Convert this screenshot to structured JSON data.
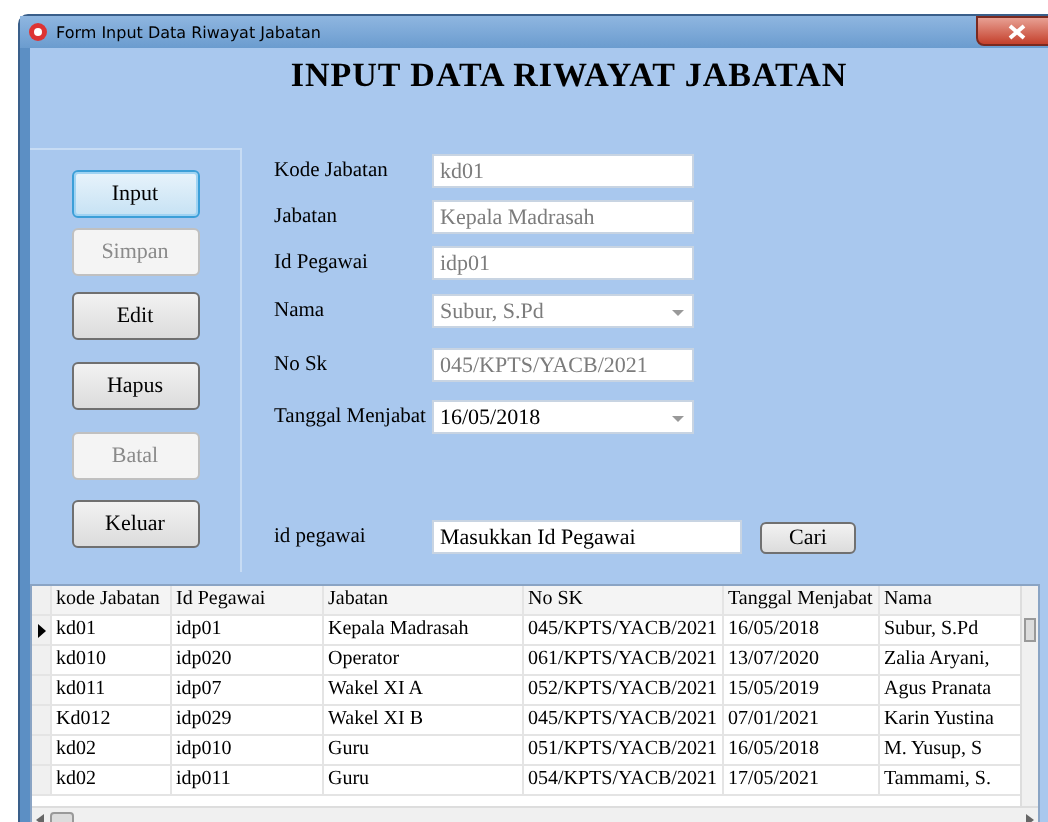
{
  "window": {
    "title": "Form Input Data Riwayat Jabatan"
  },
  "heading": "INPUT DATA RIWAYAT JABATAN",
  "buttons": [
    {
      "label": "Input",
      "disabled": false,
      "focused": true
    },
    {
      "label": "Simpan",
      "disabled": true,
      "focused": false
    },
    {
      "label": "Edit",
      "disabled": false,
      "focused": false
    },
    {
      "label": "Hapus",
      "disabled": false,
      "focused": false
    },
    {
      "label": "Batal",
      "disabled": true,
      "focused": false
    },
    {
      "label": "Keluar",
      "disabled": false,
      "focused": false
    }
  ],
  "fields": [
    {
      "label": "Kode Jabatan",
      "value": "kd01",
      "kind": "text",
      "disabled": true
    },
    {
      "label": "Jabatan",
      "value": "Kepala Madrasah",
      "kind": "text",
      "disabled": true
    },
    {
      "label": "Id Pegawai",
      "value": "idp01",
      "kind": "text",
      "disabled": true
    },
    {
      "label": "Nama",
      "value": "Subur, S.Pd",
      "kind": "combo",
      "disabled": true
    },
    {
      "label": "No Sk",
      "value": "045/KPTS/YACB/2021",
      "kind": "text",
      "disabled": true
    },
    {
      "label": "Tanggal Menjabat",
      "value": "16/05/2018",
      "kind": "combo",
      "disabled": false
    }
  ],
  "search": {
    "label": "id pegawai",
    "value": "Masukkan Id Pegawai",
    "button": "Cari"
  },
  "table": {
    "columns": [
      "kode Jabatan",
      "Id Pegawai",
      "Jabatan",
      "No SK",
      "Tanggal Menjabat",
      "Nama"
    ],
    "rows": [
      {
        "selected": true,
        "cells": [
          "kd01",
          "idp01",
          "Kepala Madrasah",
          "045/KPTS/YACB/2021",
          "16/05/2018",
          "Subur, S.Pd"
        ]
      },
      {
        "selected": false,
        "cells": [
          "kd010",
          "idp020",
          "Operator",
          "061/KPTS/YACB/2021",
          "13/07/2020",
          "Zalia Aryani,"
        ]
      },
      {
        "selected": false,
        "cells": [
          "kd011",
          "idp07",
          "Wakel XI A",
          "052/KPTS/YACB/2021",
          "15/05/2019",
          "Agus Pranata"
        ]
      },
      {
        "selected": false,
        "cells": [
          "Kd012",
          "idp029",
          "Wakel XI B",
          "045/KPTS/YACB/2021",
          "07/01/2021",
          "Karin Yustina"
        ]
      },
      {
        "selected": false,
        "cells": [
          "kd02",
          "idp010",
          "Guru",
          "051/KPTS/YACB/2021",
          "16/05/2018",
          "M. Yusup, S"
        ]
      },
      {
        "selected": false,
        "cells": [
          "kd02",
          "idp011",
          "Guru",
          "054/KPTS/YACB/2021",
          "17/05/2021",
          "Tammami, S."
        ]
      }
    ]
  }
}
